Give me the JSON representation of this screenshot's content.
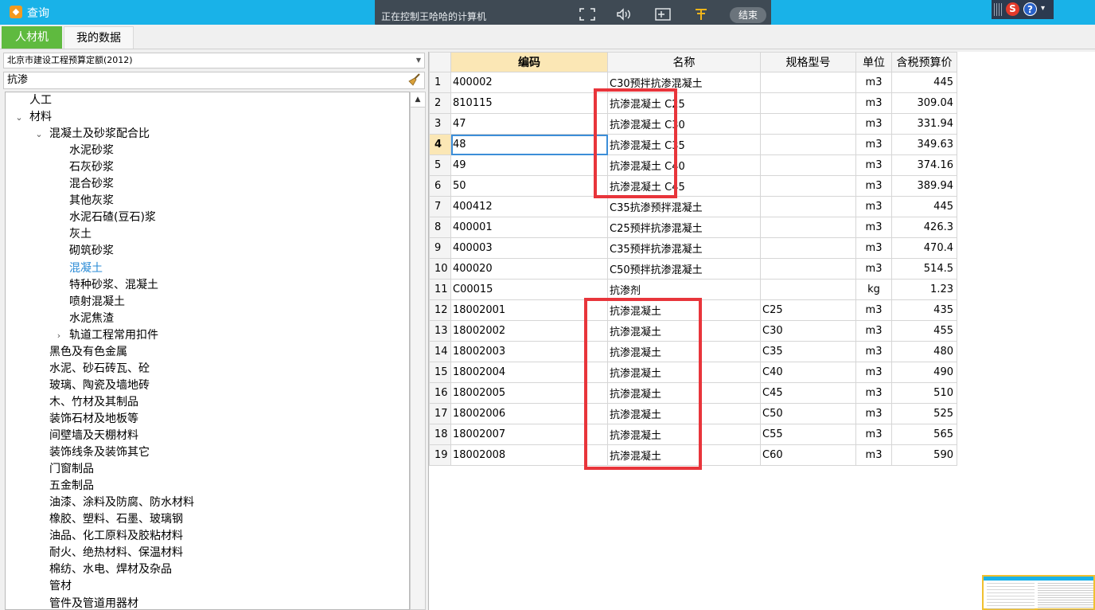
{
  "window": {
    "title": "查询"
  },
  "remote_bar": {
    "status_text": "正在控制王哈哈的计算机",
    "end_label": "结束"
  },
  "tabs": [
    {
      "label": "人材机",
      "active": true
    },
    {
      "label": "我的数据",
      "active": false
    }
  ],
  "left_panel": {
    "quota_select": "北京市建设工程预算定额(2012)",
    "search_value": "抗渗",
    "tree": [
      {
        "label": "人工",
        "level": 0,
        "toggle": ""
      },
      {
        "label": "材料",
        "level": 0,
        "toggle": "v"
      },
      {
        "label": "混凝土及砂浆配合比",
        "level": 1,
        "toggle": "v"
      },
      {
        "label": "水泥砂浆",
        "level": 2,
        "toggle": ""
      },
      {
        "label": "石灰砂浆",
        "level": 2,
        "toggle": ""
      },
      {
        "label": "混合砂浆",
        "level": 2,
        "toggle": ""
      },
      {
        "label": "其他灰浆",
        "level": 2,
        "toggle": ""
      },
      {
        "label": "水泥石碴(豆石)浆",
        "level": 2,
        "toggle": ""
      },
      {
        "label": "灰土",
        "level": 2,
        "toggle": ""
      },
      {
        "label": "砌筑砂浆",
        "level": 2,
        "toggle": ""
      },
      {
        "label": "混凝土",
        "level": 2,
        "toggle": "",
        "selected": true
      },
      {
        "label": "特种砂浆、混凝土",
        "level": 2,
        "toggle": ""
      },
      {
        "label": "喷射混凝土",
        "level": 2,
        "toggle": ""
      },
      {
        "label": "水泥焦渣",
        "level": 2,
        "toggle": ""
      },
      {
        "label": "轨道工程常用扣件",
        "level": 2,
        "toggle": ">"
      },
      {
        "label": "黑色及有色金属",
        "level": 1,
        "toggle": ""
      },
      {
        "label": "水泥、砂石砖瓦、砼",
        "level": 1,
        "toggle": ""
      },
      {
        "label": "玻璃、陶瓷及墙地砖",
        "level": 1,
        "toggle": ""
      },
      {
        "label": "木、竹材及其制品",
        "level": 1,
        "toggle": ""
      },
      {
        "label": "装饰石材及地板等",
        "level": 1,
        "toggle": ""
      },
      {
        "label": "间壁墙及天棚材料",
        "level": 1,
        "toggle": ""
      },
      {
        "label": "装饰线条及装饰其它",
        "level": 1,
        "toggle": ""
      },
      {
        "label": "门窗制品",
        "level": 1,
        "toggle": ""
      },
      {
        "label": "五金制品",
        "level": 1,
        "toggle": ""
      },
      {
        "label": "油漆、涂料及防腐、防水材料",
        "level": 1,
        "toggle": ""
      },
      {
        "label": "橡胶、塑料、石墨、玻璃钢",
        "level": 1,
        "toggle": ""
      },
      {
        "label": "油品、化工原料及胶粘材料",
        "level": 1,
        "toggle": ""
      },
      {
        "label": "耐火、绝热材料、保温材料",
        "level": 1,
        "toggle": ""
      },
      {
        "label": "棉纺、水电、焊材及杂品",
        "level": 1,
        "toggle": ""
      },
      {
        "label": "管材",
        "level": 1,
        "toggle": ""
      },
      {
        "label": "管件及管道用器材",
        "level": 1,
        "toggle": ""
      }
    ]
  },
  "grid": {
    "headers": [
      "",
      "编码",
      "名称",
      "规格型号",
      "单位",
      "含税预算价"
    ],
    "current_row": 4,
    "rows": [
      [
        "1",
        "400002",
        "C30预拌抗渗混凝土",
        "",
        "m3",
        "445"
      ],
      [
        "2",
        "810115",
        "抗渗混凝土 C25",
        "",
        "m3",
        "309.04"
      ],
      [
        "3",
        "47",
        "抗渗混凝土 C30",
        "",
        "m3",
        "331.94"
      ],
      [
        "4",
        "48",
        "抗渗混凝土 C35",
        "",
        "m3",
        "349.63"
      ],
      [
        "5",
        "49",
        "抗渗混凝土 C40",
        "",
        "m3",
        "374.16"
      ],
      [
        "6",
        "50",
        "抗渗混凝土 C45",
        "",
        "m3",
        "389.94"
      ],
      [
        "7",
        "400412",
        "C35抗渗预拌混凝土",
        "",
        "m3",
        "445"
      ],
      [
        "8",
        "400001",
        "C25预拌抗渗混凝土",
        "",
        "m3",
        "426.3"
      ],
      [
        "9",
        "400003",
        "C35预拌抗渗混凝土",
        "",
        "m3",
        "470.4"
      ],
      [
        "10",
        "400020",
        "C50预拌抗渗混凝土",
        "",
        "m3",
        "514.5"
      ],
      [
        "11",
        "C00015",
        "抗渗剂",
        "",
        "kg",
        "1.23"
      ],
      [
        "12",
        "18002001",
        "抗渗混凝土",
        "C25",
        "m3",
        "435"
      ],
      [
        "13",
        "18002002",
        "抗渗混凝土",
        "C30",
        "m3",
        "455"
      ],
      [
        "14",
        "18002003",
        "抗渗混凝土",
        "C35",
        "m3",
        "480"
      ],
      [
        "15",
        "18002004",
        "抗渗混凝土",
        "C40",
        "m3",
        "490"
      ],
      [
        "16",
        "18002005",
        "抗渗混凝土",
        "C45",
        "m3",
        "510"
      ],
      [
        "17",
        "18002006",
        "抗渗混凝土",
        "C50",
        "m3",
        "525"
      ],
      [
        "18",
        "18002007",
        "抗渗混凝土",
        "C55",
        "m3",
        "565"
      ],
      [
        "19",
        "18002008",
        "抗渗混凝土",
        "C60",
        "m3",
        "590"
      ]
    ]
  },
  "colors": {
    "titlebar": "#19b2e8",
    "active_tab": "#5fba3f",
    "highlight_box": "#e8353b",
    "header_highlight": "#fbe7b5"
  }
}
